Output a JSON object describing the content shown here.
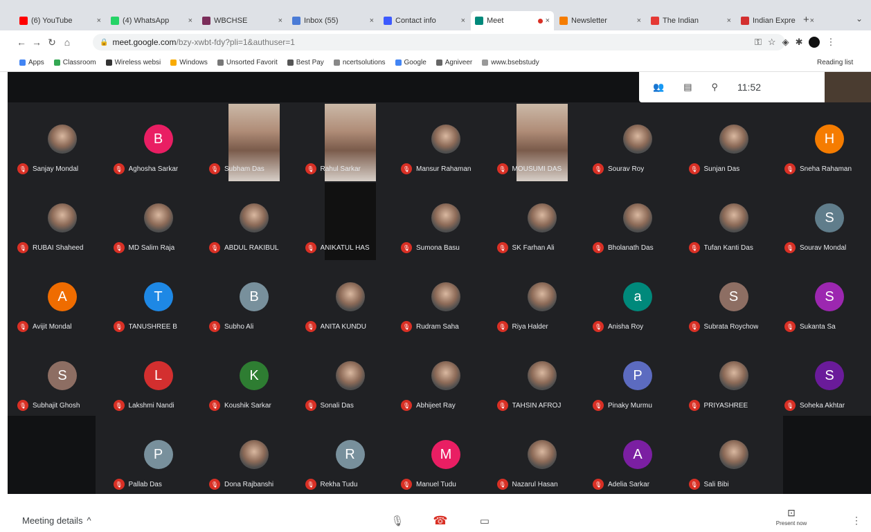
{
  "browser": {
    "tabs": [
      {
        "title": "(6) YouTube",
        "favicon_color": "#ff0000"
      },
      {
        "title": "(4) WhatsApp",
        "favicon_color": "#25d366"
      },
      {
        "title": "WBCHSE",
        "favicon_color": "#7b2d5a"
      },
      {
        "title": "Inbox (55)",
        "favicon_color": "#4a7bd6"
      },
      {
        "title": "Contact info",
        "favicon_color": "#3d5afe"
      },
      {
        "title": "Meet",
        "favicon_color": "#00897b",
        "active": true,
        "recording": true
      },
      {
        "title": "Newsletter",
        "favicon_color": "#f57c00"
      },
      {
        "title": "The Indian",
        "favicon_color": "#e53935"
      },
      {
        "title": "Indian Expre",
        "favicon_color": "#d32f2f"
      }
    ],
    "new_tab": "+",
    "address": {
      "host": "meet.google.com",
      "path": "/bzy-xwbt-fdy?pli=1&authuser=1"
    },
    "bookmarks": [
      "Apps",
      "Classroom",
      "Wireless websi",
      "Windows",
      "Unsorted Favorit",
      "Best Pay",
      "ncertsolutions",
      "Google",
      "Agniveer",
      "www.bsebstudy"
    ],
    "reading_list": "Reading list"
  },
  "meet": {
    "clock": "11:52",
    "top_icons": [
      "people-icon",
      "chat-icon",
      "activities-icon"
    ],
    "participants": [
      {
        "name": "Sanjay Mondal",
        "avatar": "photo"
      },
      {
        "name": "Aghosha Sarkar",
        "avatar": "B",
        "color": "#e91e63"
      },
      {
        "name": "Subham Das",
        "avatar": "video"
      },
      {
        "name": "Rahul Sarkar",
        "avatar": "video"
      },
      {
        "name": "Mansur Rahaman",
        "avatar": "photo"
      },
      {
        "name": "MOUSUMI DAS",
        "avatar": "video"
      },
      {
        "name": "Sourav Roy",
        "avatar": "photo"
      },
      {
        "name": "Sunjan Das",
        "avatar": "photo"
      },
      {
        "name": "Sneha Rahaman",
        "avatar": "H",
        "color": "#f57c00"
      },
      {
        "name": "RUBAI Shaheed",
        "avatar": "photo"
      },
      {
        "name": "MD Salim Raja",
        "avatar": "photo"
      },
      {
        "name": "ABDUL RAKIBUL",
        "avatar": "photo"
      },
      {
        "name": "ANIKATUL HAS",
        "avatar": "video-dark"
      },
      {
        "name": "Sumona Basu",
        "avatar": "photo"
      },
      {
        "name": "SK Farhan Ali",
        "avatar": "photo"
      },
      {
        "name": "Bholanath Das",
        "avatar": "photo"
      },
      {
        "name": "Tufan Kanti Das",
        "avatar": "photo"
      },
      {
        "name": "Sourav Mondal",
        "avatar": "S",
        "color": "#607d8b"
      },
      {
        "name": "Avijit Mondal",
        "avatar": "A",
        "color": "#ef6c00"
      },
      {
        "name": "TANUSHREE B",
        "avatar": "T",
        "color": "#1e88e5"
      },
      {
        "name": "Subho Ali",
        "avatar": "B",
        "color": "#78909c"
      },
      {
        "name": "ANITA KUNDU",
        "avatar": "photo"
      },
      {
        "name": "Rudram Saha",
        "avatar": "photo"
      },
      {
        "name": "Riya Halder",
        "avatar": "photo"
      },
      {
        "name": "Anisha Roy",
        "avatar": "a",
        "color": "#00897b"
      },
      {
        "name": "Subrata Roychow",
        "avatar": "S",
        "color": "#8d6e63"
      },
      {
        "name": "Sukanta Sa",
        "avatar": "S",
        "color": "#9c27b0"
      },
      {
        "name": "Subhajit Ghosh",
        "avatar": "S",
        "color": "#8d6e63"
      },
      {
        "name": "Lakshmi Nandi",
        "avatar": "L",
        "color": "#d32f2f"
      },
      {
        "name": "Koushik Sarkar",
        "avatar": "K",
        "color": "#2e7d32"
      },
      {
        "name": "Sonali Das",
        "avatar": "photo"
      },
      {
        "name": "Abhijeet Ray",
        "avatar": "photo"
      },
      {
        "name": "TAHSIN AFROJ",
        "avatar": "photo"
      },
      {
        "name": "Pinaky Murmu",
        "avatar": "P",
        "color": "#5c6bc0"
      },
      {
        "name": "PRIYASHREE",
        "avatar": "photo"
      },
      {
        "name": "Soheka Akhtar",
        "avatar": "S",
        "color": "#6a1b9a"
      },
      {
        "name": "Pallab Das",
        "avatar": "P",
        "color": "#78909c"
      },
      {
        "name": "Dona Rajbanshi",
        "avatar": "photo"
      },
      {
        "name": "Rekha Tudu",
        "avatar": "R",
        "color": "#78909c"
      },
      {
        "name": "Manuel Tudu",
        "avatar": "M",
        "color": "#e91e63"
      },
      {
        "name": "Nazarul Hasan",
        "avatar": "photo"
      },
      {
        "name": "Adelia Sarkar",
        "avatar": "A",
        "color": "#7b1fa2"
      },
      {
        "name": "Sali Bibi",
        "avatar": "photo"
      }
    ]
  },
  "bottom": {
    "meeting_details": "Meeting details",
    "meeting_details_chevron": "^",
    "present_now": "Present now",
    "present_icon": "⊡",
    "more_icon": "⋮"
  },
  "colors": {
    "mic_off": "#d93025",
    "meet_bg": "#202124"
  }
}
